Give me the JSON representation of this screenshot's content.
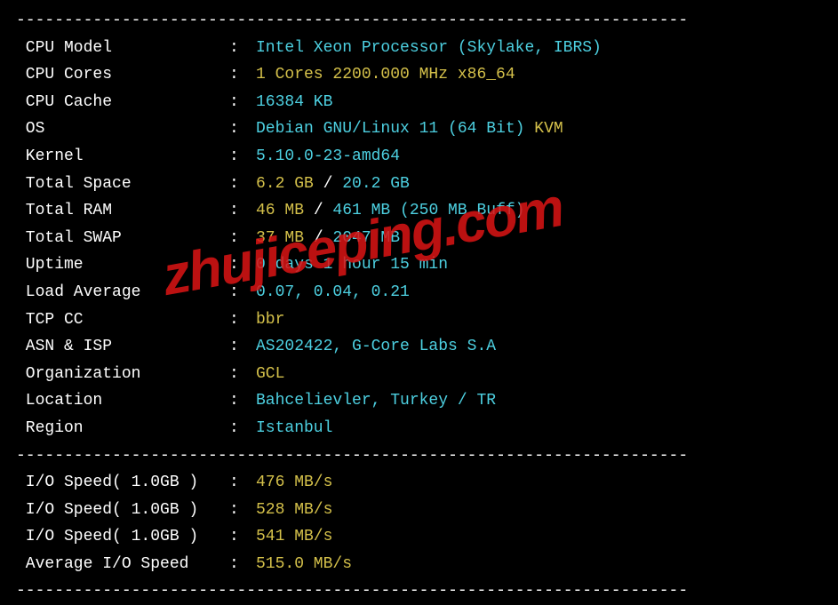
{
  "divider": "----------------------------------------------------------------------",
  "watermark": "zhujiceping.com",
  "sysinfo": [
    {
      "label": "CPU Model",
      "segments": [
        {
          "text": "Intel Xeon Processor (Skylake, IBRS)",
          "cls": "cyan"
        }
      ]
    },
    {
      "label": "CPU Cores",
      "segments": [
        {
          "text": "1 Cores 2200.000 MHz x86_64",
          "cls": "yellow"
        }
      ]
    },
    {
      "label": "CPU Cache",
      "segments": [
        {
          "text": "16384 KB",
          "cls": "cyan"
        }
      ]
    },
    {
      "label": "OS",
      "segments": [
        {
          "text": "Debian GNU/Linux 11 (64 Bit) ",
          "cls": "cyan"
        },
        {
          "text": "KVM",
          "cls": "yellow"
        }
      ]
    },
    {
      "label": "Kernel",
      "segments": [
        {
          "text": "5.10.0-23-amd64",
          "cls": "cyan"
        }
      ]
    },
    {
      "label": "Total Space",
      "segments": [
        {
          "text": "6.2 GB ",
          "cls": "yellow"
        },
        {
          "text": "/ ",
          "cls": "white"
        },
        {
          "text": "20.2 GB",
          "cls": "cyan"
        }
      ]
    },
    {
      "label": "Total RAM",
      "segments": [
        {
          "text": "46 MB ",
          "cls": "yellow"
        },
        {
          "text": "/ ",
          "cls": "white"
        },
        {
          "text": "461 MB ",
          "cls": "cyan"
        },
        {
          "text": "(250 MB Buff)",
          "cls": "cyan"
        }
      ]
    },
    {
      "label": "Total SWAP",
      "segments": [
        {
          "text": "37 MB ",
          "cls": "yellow"
        },
        {
          "text": "/ ",
          "cls": "white"
        },
        {
          "text": "2047 MB",
          "cls": "cyan"
        }
      ]
    },
    {
      "label": "Uptime",
      "segments": [
        {
          "text": "0 days 1 hour 15 min",
          "cls": "cyan"
        }
      ]
    },
    {
      "label": "Load Average",
      "segments": [
        {
          "text": "0.07, 0.04, 0.21",
          "cls": "cyan"
        }
      ]
    },
    {
      "label": "TCP CC",
      "segments": [
        {
          "text": "bbr",
          "cls": "yellow"
        }
      ]
    },
    {
      "label": "ASN & ISP",
      "segments": [
        {
          "text": "AS202422, G-Core Labs S.A",
          "cls": "cyan"
        }
      ]
    },
    {
      "label": "Organization",
      "segments": [
        {
          "text": "GCL",
          "cls": "yellow"
        }
      ]
    },
    {
      "label": "Location",
      "segments": [
        {
          "text": "Bahcelievler, Turkey / TR",
          "cls": "cyan"
        }
      ]
    },
    {
      "label": "Region",
      "segments": [
        {
          "text": "Istanbul",
          "cls": "cyan"
        }
      ]
    }
  ],
  "iospeed": [
    {
      "label": "I/O Speed( 1.0GB )",
      "segments": [
        {
          "text": "476 MB/s",
          "cls": "yellow"
        }
      ]
    },
    {
      "label": "I/O Speed( 1.0GB )",
      "segments": [
        {
          "text": "528 MB/s",
          "cls": "yellow"
        }
      ]
    },
    {
      "label": "I/O Speed( 1.0GB )",
      "segments": [
        {
          "text": "541 MB/s",
          "cls": "yellow"
        }
      ]
    },
    {
      "label": "Average I/O Speed",
      "segments": [
        {
          "text": "515.0 MB/s",
          "cls": "yellow"
        }
      ]
    }
  ]
}
